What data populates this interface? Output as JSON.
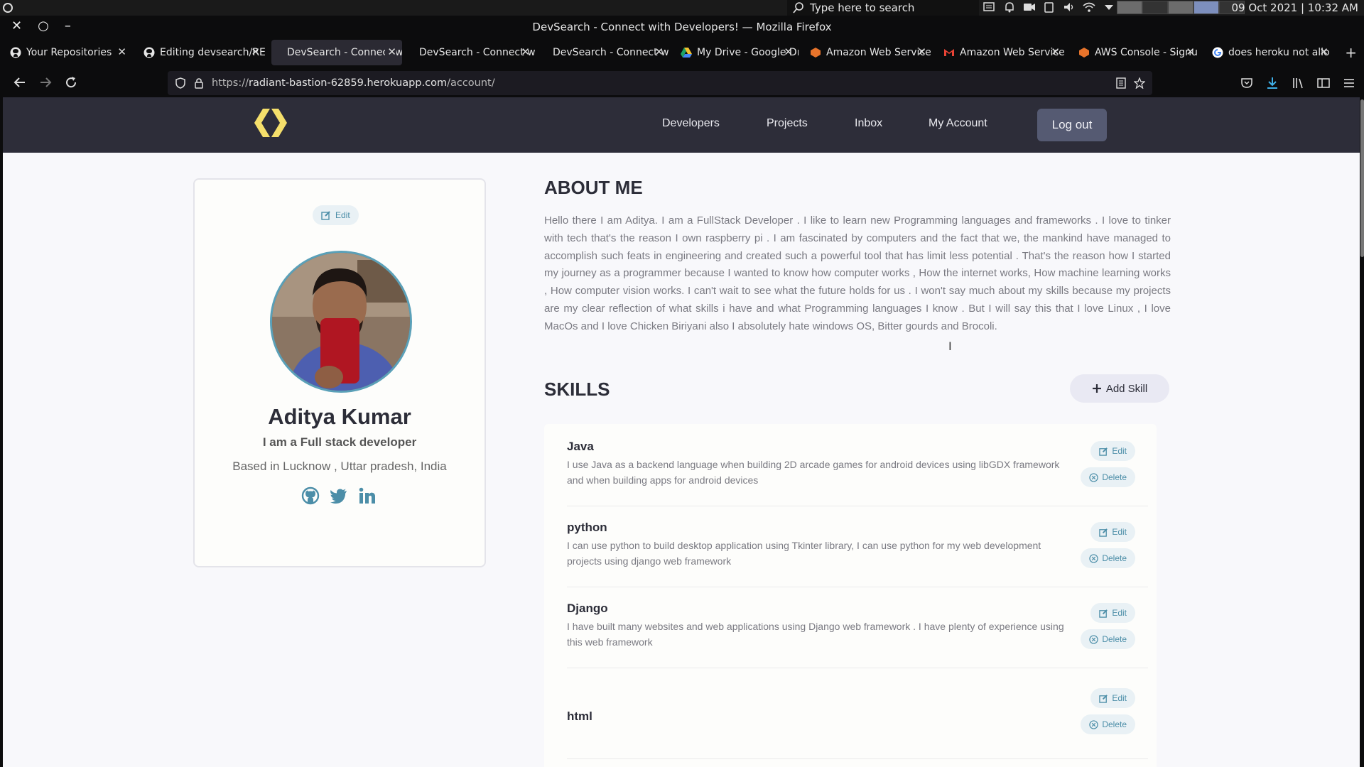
{
  "os": {
    "search_placeholder": "Type here to search",
    "clock": "09 Oct 2021 | 10:32 AM"
  },
  "window": {
    "title": "DevSearch - Connect with Developers! — Mozilla Firefox",
    "close": "✕",
    "restore": "○",
    "minimize": "–"
  },
  "tabs": [
    {
      "label": "Your Repositories",
      "icon": "github-icon",
      "active": false
    },
    {
      "label": "Editing devsearch/RE",
      "icon": "github-icon",
      "active": false
    },
    {
      "label": "DevSearch - Connect wit",
      "icon": "none",
      "active": true
    },
    {
      "label": "DevSearch - Connect wit",
      "icon": "none",
      "active": false
    },
    {
      "label": "DevSearch - Connect wit",
      "icon": "none",
      "active": false
    },
    {
      "label": "My Drive - Google Dr",
      "icon": "google-drive-icon",
      "active": false
    },
    {
      "label": "Amazon Web Service",
      "icon": "aws-icon",
      "active": false
    },
    {
      "label": "Amazon Web Service",
      "icon": "gmail-icon",
      "active": false
    },
    {
      "label": "AWS Console - Signu",
      "icon": "aws-icon",
      "active": false
    },
    {
      "label": "does heroku not allo",
      "icon": "google-icon",
      "active": false
    }
  ],
  "url": {
    "scheme": "https://",
    "host": "radiant-bastion-62859.herokuapp.com",
    "path": "/account/"
  },
  "site_nav": {
    "developers": "Developers",
    "projects": "Projects",
    "inbox": "Inbox",
    "my_account": "My Account",
    "logout": "Log out"
  },
  "profile": {
    "edit_label": "Edit",
    "name": "Aditya Kumar",
    "headline": "I am a Full stack developer",
    "location": "Based in Lucknow , Uttar pradesh, India"
  },
  "about": {
    "heading": "ABOUT ME",
    "text": "Hello there I am Aditya. I am a FullStack Developer . I like to learn new Programming languages and frameworks . I love to tinker with tech that's the reason I own raspberry pi . I am fascinated by computers and the fact that we, the mankind have managed to accomplish such feats in engineering and created such a powerful tool that has limit less potential . That's the reason how I started my journey as a programmer because I wanted to know how computer works , How the internet works, How machine learning works , How computer vision works. I can't wait to see what the future holds for us . I won't say much about my skills because my projects are my clear reflection of what skills i have and what Programming languages I know . But I will say this that I love Linux , I love MacOs and I love Chicken Biriyani also I absolutely hate windows OS, Bitter gourds and Brocoli."
  },
  "skills": {
    "heading": "SKILLS",
    "add_label": "Add Skill",
    "edit_label": "Edit",
    "delete_label": "Delete",
    "items": [
      {
        "name": "Java",
        "desc": "I use Java as a backend language when building 2D arcade games for android devices using libGDX framework and when building apps for android devices"
      },
      {
        "name": "python",
        "desc": "I can use python to build desktop application using Tkinter library, I can use python for my web development projects using django web framework"
      },
      {
        "name": "Django",
        "desc": "I have built many websites and web applications using Django web framework . I have plenty of experience using this web framework"
      },
      {
        "name": "html",
        "desc": ""
      }
    ]
  },
  "colors": {
    "site_header": "#2d2d39",
    "accent": "#4c8ea8",
    "logo": "#f5df6b"
  }
}
